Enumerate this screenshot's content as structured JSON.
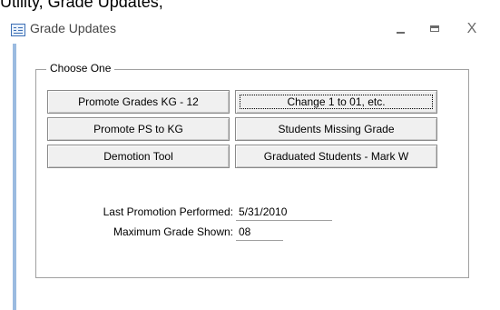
{
  "caption": "Utility, Grade Updates,",
  "window": {
    "title": "Grade Updates",
    "controls": {
      "minimize": "_",
      "maximize": "□",
      "close": "X"
    }
  },
  "group": {
    "legend": "Choose One",
    "buttons": {
      "promote_grades": "Promote Grades KG - 12",
      "change_codes": "Change 1 to 01, etc.",
      "promote_ps": "Promote PS to KG",
      "students_missing": "Students Missing Grade",
      "demotion": "Demotion Tool",
      "graduated": "Graduated Students - Mark W"
    },
    "fields": {
      "last_promotion_label": "Last Promotion Performed:",
      "last_promotion_value": "5/31/2010",
      "max_grade_label": "Maximum Grade Shown:",
      "max_grade_value": "08"
    }
  },
  "colors": {
    "accent_border": "#9bbbe0",
    "icon_blue": "#3d6fb5"
  },
  "icons": [
    "form-window-icon",
    "minimize-icon",
    "maximize-icon",
    "close-icon"
  ]
}
